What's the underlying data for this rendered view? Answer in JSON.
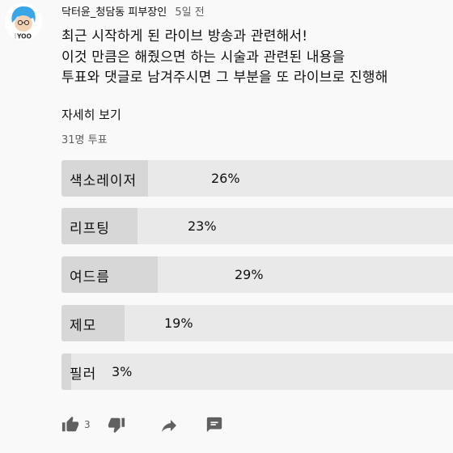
{
  "comment": {
    "avatar_text": "YOO",
    "author": "닥터윤_청담동 피부장인",
    "time_ago": "5일 전",
    "body_lines": [
      "최근 시작하게 된 라이브 방송과 관련해서!",
      "이것 만큼은 해줬으면 하는 시술과 관련된 내용을",
      "투표와 댓글로 남겨주시면 그 부분을 또 라이브로 진행해"
    ],
    "read_more": "자세히 보기"
  },
  "poll": {
    "votes": "31명 투표",
    "options": [
      {
        "label": "색소레이저",
        "pct_text": "26%",
        "pct": 26
      },
      {
        "label": "리프팅",
        "pct_text": "23%",
        "pct": 23
      },
      {
        "label": "여드름",
        "pct_text": "29%",
        "pct": 29
      },
      {
        "label": "제모",
        "pct_text": "19%",
        "pct": 19
      },
      {
        "label": "필러",
        "pct_text": "3%",
        "pct": 3
      }
    ]
  },
  "actions": {
    "like_count": "3",
    "icons": [
      "thumb-up-icon",
      "thumb-down-icon",
      "share-icon",
      "reply-icon"
    ]
  },
  "colors": {
    "bar_track": "#e9e9e9",
    "bar_fill": "#d7d7d7",
    "icon": "#606060",
    "avatar_hair": "#3aa6e8"
  }
}
